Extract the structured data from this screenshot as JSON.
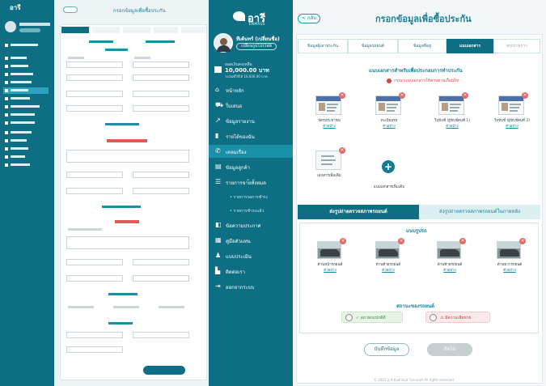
{
  "app": {
    "logo_text": "อารี",
    "logo_sub": "ENMASS"
  },
  "user": {
    "name": "ทีเค้นทร์ (เปลี่ยนชื่อ)",
    "badge": "เปลี่ยนรูปโปรไฟล์"
  },
  "balance": {
    "label": "ยอดเงินคงเหลือ",
    "value": "10,000.00 บาท",
    "sub": "วงเงินที่ใช้ได้ 10,000.00 บาท"
  },
  "sidebar": {
    "items": [
      {
        "label": "หน้าหลัก",
        "icon": "home-icon",
        "glyph": "⌂"
      },
      {
        "label": "ใบเสนอ",
        "icon": "truck-icon",
        "glyph": "⛟"
      },
      {
        "label": "ข้อมูลรายงาน",
        "icon": "chart-line-icon",
        "glyph": "↗"
      },
      {
        "label": "รายได้ของฉัน",
        "icon": "bar-chart-icon",
        "glyph": "▮"
      },
      {
        "label": "เคลมเรื่อง",
        "icon": "phone-icon",
        "glyph": "✆",
        "active": true
      },
      {
        "label": "ข้อมูลลูกค้า",
        "icon": "document-icon",
        "glyph": "▤"
      },
      {
        "label": "รายการขายทั้งหมด",
        "icon": "list-icon",
        "glyph": "☰",
        "expandable": true
      },
      {
        "label": "• รายการรอการชำระ",
        "icon": "",
        "glyph": "",
        "sub": true
      },
      {
        "label": "• รายการชำระแล้ว",
        "icon": "",
        "glyph": "",
        "sub": true
      },
      {
        "label": "ข้อความประกาศ",
        "icon": "megaphone-icon",
        "glyph": "◧"
      },
      {
        "label": "คู่มือตัวแทน",
        "icon": "book-icon",
        "glyph": "▦"
      },
      {
        "label": "แบบประเมิน",
        "icon": "people-icon",
        "glyph": "♟"
      },
      {
        "label": "ติดต่อเรา",
        "icon": "building-icon",
        "glyph": "▙"
      },
      {
        "label": "ออกจากระบบ",
        "icon": "logout-icon",
        "glyph": "⇥"
      }
    ]
  },
  "page": {
    "back_label": "< กลับ",
    "title": "กรอกข้อมูลเพื่อซื้อประกัน"
  },
  "steps": [
    {
      "label": "ข้อมูลผู้เอาประกัน",
      "state": "done"
    },
    {
      "label": "ข้อมูลรถยนต์",
      "state": "done"
    },
    {
      "label": "ข้อมูลที่อยู่",
      "state": "done"
    },
    {
      "label": "แนบเอกสาร",
      "state": "active"
    },
    {
      "label": "สรุปรายการ",
      "state": "todo"
    }
  ],
  "documents": {
    "title": "แนบเอกสารสำหรับเพื่อประกอบการทำประกัน",
    "warning": "กรุณาแนบเอกสารให้ครบตามเงื่อนไข",
    "items": [
      {
        "caption": "บัตรประชาชน",
        "link": "ตัวอย่าง"
      },
      {
        "caption": "ทะเบียนรถ",
        "link": "ตัวอย่าง"
      },
      {
        "caption": "ใบขับขี่ (ผู้ขับขี่คนที่ 1)",
        "link": "ตัวอย่าง"
      },
      {
        "caption": "ใบขับขี่ (ผู้ขับขี่คนที่ 2)",
        "link": "ตัวอย่าง"
      },
      {
        "caption": "เอกสารเพิ่มเติม",
        "link": ""
      },
      {
        "caption": "แนบเอกสารเพิ่มเติม",
        "link": ""
      }
    ],
    "add_symbol": "+"
  },
  "vehicle_tabs": {
    "active": "ส่งรูปถ่ายตรวจสภาพรถยนต์",
    "inactive": "ส่งรูปถ่ายตรวจสภาพรถยนต์ในภายหลัง"
  },
  "vehicle": {
    "section_title": "แนบรูปรถ",
    "items": [
      {
        "caption": "ด้านหน้ารถยนต์",
        "link": "ตัวอย่าง"
      },
      {
        "caption": "ด้านท้ายรถยนต์",
        "link": "ตัวอย่าง"
      },
      {
        "caption": "ด้านซ้ายรถยนต์",
        "link": "ตัวอย่าง"
      },
      {
        "caption": "ด้านขวารถยนต์",
        "link": "ตัวอย่าง"
      }
    ],
    "status_title": "สถานะของรถยนต์",
    "ok_label": "✓ สภาพรถปกติดี",
    "bad_label": "⚠ มีความเสียหาย"
  },
  "actions": {
    "save": "บันทึกข้อมูล",
    "next": "ถัดไป"
  },
  "footer": "© 2023 อารี อินชัวรันส์ โบรกเกอร์ All rights reserved",
  "colors": {
    "primary": "#0e6e83",
    "accent": "#1b7f95",
    "danger": "#d94343",
    "success": "#2e8b40"
  }
}
